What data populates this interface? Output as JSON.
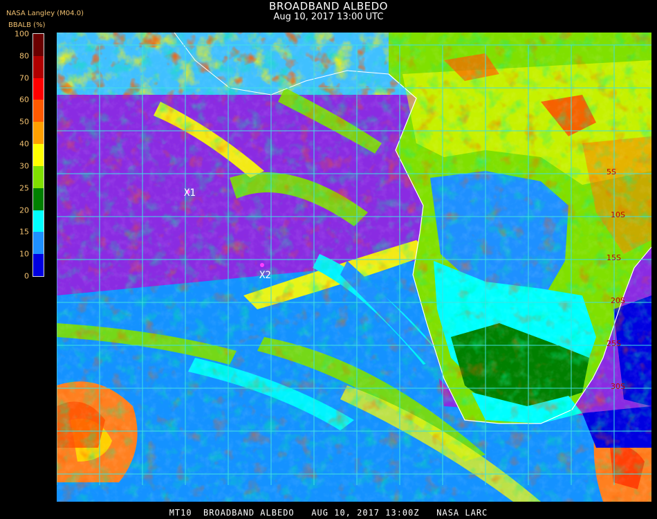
{
  "header": {
    "title": "BROADBAND ALBEDO",
    "datetime": "Aug 10, 2017 13:00 UTC",
    "source": "NASA Langley (M04.0)"
  },
  "colorbar": {
    "label": "BBALB (%)",
    "ticks": [
      "100",
      "80",
      "70",
      "60",
      "50",
      "40",
      "30",
      "25",
      "20",
      "15",
      "10",
      "0"
    ],
    "colors": [
      "#6a0000",
      "#b00000",
      "#ff0000",
      "#ff5a00",
      "#ffa000",
      "#ffff00",
      "#80e000",
      "#008000",
      "#00ffff",
      "#1e90ff",
      "#0000e0",
      "#8a2be2"
    ]
  },
  "markers": [
    {
      "label": "X1",
      "color": "#ff40ff"
    },
    {
      "label": "X2",
      "color": "#ff40ff"
    }
  ],
  "grid_labels": [
    "5S",
    "10S",
    "15S",
    "20S",
    "25S",
    "30S"
  ],
  "footer": "MT10  BROADBAND ALBEDO   AUG 10, 2017 13:00Z   NASA LARC",
  "colors": {
    "ocean_clear": "#8a2be2",
    "land_low": "#1e90ff",
    "land_mid": "#00ffff",
    "land_green": "#008000",
    "grid": "#40e0e0",
    "coast": "#ffffff"
  }
}
